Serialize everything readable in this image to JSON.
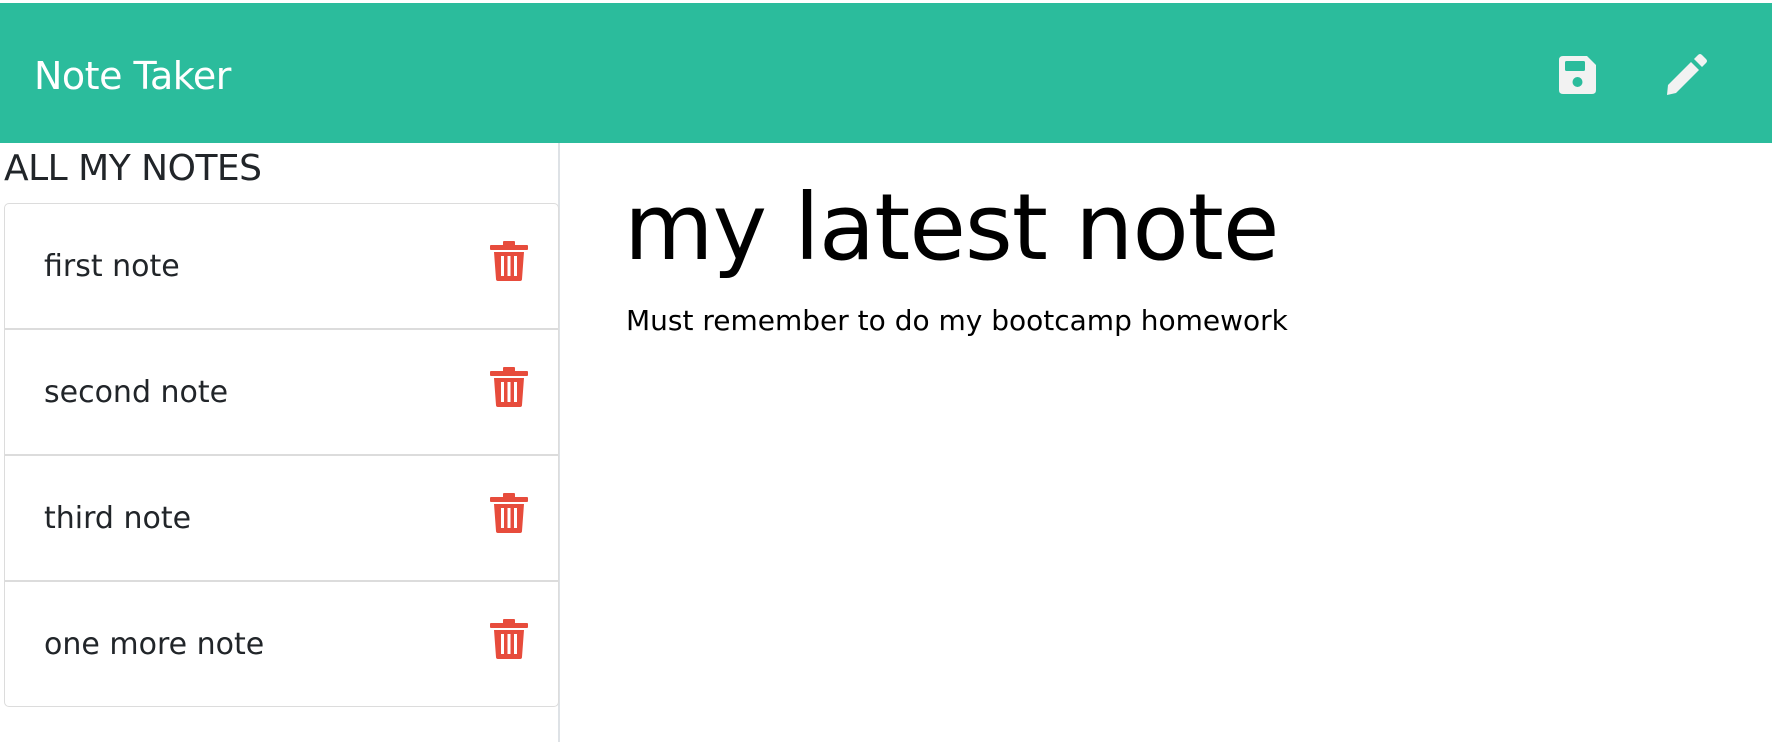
{
  "header": {
    "title": "Note Taker",
    "save_icon": "floppy-disk-icon",
    "new_icon": "pencil-icon",
    "background_color": "#2bbc9c"
  },
  "sidebar": {
    "title": "ALL MY NOTES",
    "delete_icon": "trash-icon",
    "delete_color": "#e74c3c",
    "notes": [
      {
        "title": "first note"
      },
      {
        "title": "second note"
      },
      {
        "title": "third note"
      },
      {
        "title": "one more note"
      }
    ]
  },
  "active_note": {
    "title": "my latest note",
    "text": "Must remember to do my bootcamp homework"
  }
}
